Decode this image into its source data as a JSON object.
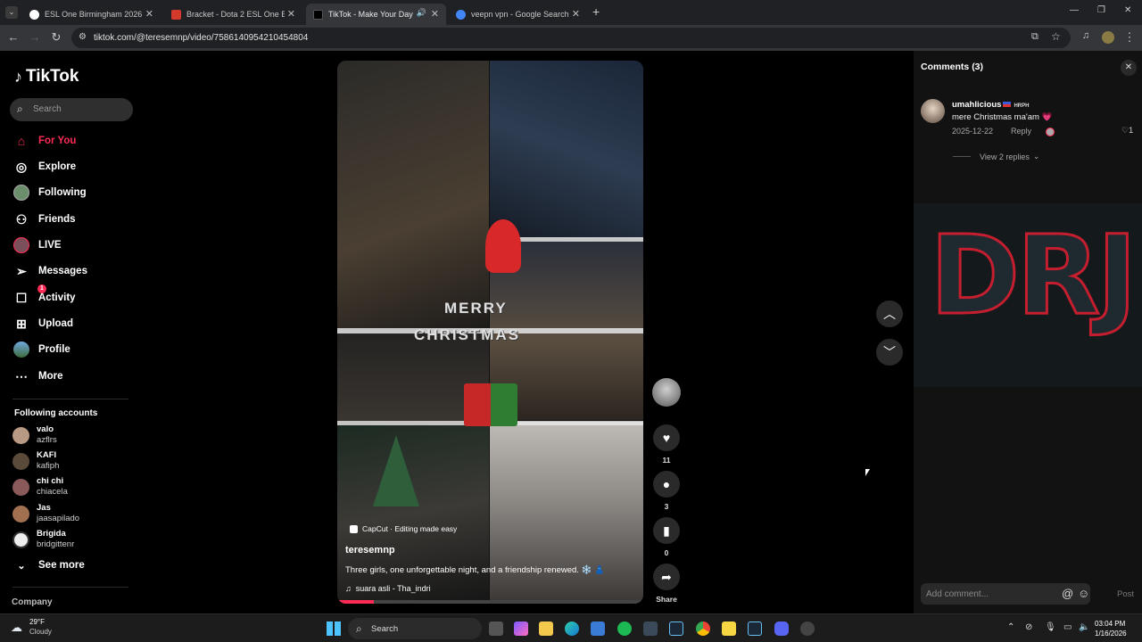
{
  "browser": {
    "tabs": [
      {
        "title": "ESL One Birmingham 2026: Sou",
        "favicon_color": "#ffffff"
      },
      {
        "title": "Bracket - Dota 2 ESL One Birmi",
        "favicon_color": "#d33a2c"
      },
      {
        "title": "TikTok - Make Your Day",
        "favicon_color": "#000000"
      },
      {
        "title": "veepn vpn - Google Search",
        "favicon_color": "#4285f4"
      }
    ],
    "new_tab": "+",
    "url": "tiktok.com/@teresemnp/video/7586140954210454804"
  },
  "sidebar": {
    "logo": "TikTok",
    "search_placeholder": "Search",
    "nav": [
      {
        "label": "For You",
        "icon": "home-icon"
      },
      {
        "label": "Explore",
        "icon": "compass-icon"
      },
      {
        "label": "Following",
        "icon": "avatar-icon"
      },
      {
        "label": "Friends",
        "icon": "friends-icon"
      },
      {
        "label": "LIVE",
        "icon": "live-icon"
      },
      {
        "label": "Messages",
        "icon": "send-icon"
      },
      {
        "label": "Activity",
        "icon": "activity-icon",
        "badge": "1"
      },
      {
        "label": "Upload",
        "icon": "upload-icon"
      },
      {
        "label": "Profile",
        "icon": "profile-icon"
      },
      {
        "label": "More",
        "icon": "more-icon"
      }
    ],
    "following_title": "Following accounts",
    "accounts": [
      {
        "name": "valo",
        "handle": "azflrs"
      },
      {
        "name": "KAFI",
        "handle": "kafiph"
      },
      {
        "name": "chi chi",
        "handle": "chiacela"
      },
      {
        "name": "Jas",
        "handle": "jaasapilado"
      },
      {
        "name": "Brigida",
        "handle": "bridgittenr"
      }
    ],
    "see_more": "See more",
    "company": "Company"
  },
  "video": {
    "overlay_line1": "MERRY",
    "overlay_line2": "CHRISTMAS",
    "capcut": "CapCut · Editing made easy",
    "username": "teresemnp",
    "description": "Three girls, one unforgettable night, and a friendship renewed. ❄️ 👗",
    "music": "suara asli - Tha_indri",
    "likes": "11",
    "comments": "3",
    "saves": "0",
    "share": "Share"
  },
  "comments_panel": {
    "title": "Comments",
    "count": "(3)",
    "comment": {
      "user": "umahlicious",
      "flag_tag": "HRPH",
      "text": "mere Christmas ma'am 💗",
      "date": "2025-12-22",
      "reply": "Reply",
      "likes": "1"
    },
    "view_replies": "View 2 replies",
    "ad_text": "DRJ",
    "add_placeholder": "Add comment...",
    "post": "Post"
  },
  "taskbar": {
    "temp": "29°F",
    "weather": "Cloudy",
    "search": "Search",
    "time": "03:04 PM",
    "date": "1/16/2026"
  }
}
